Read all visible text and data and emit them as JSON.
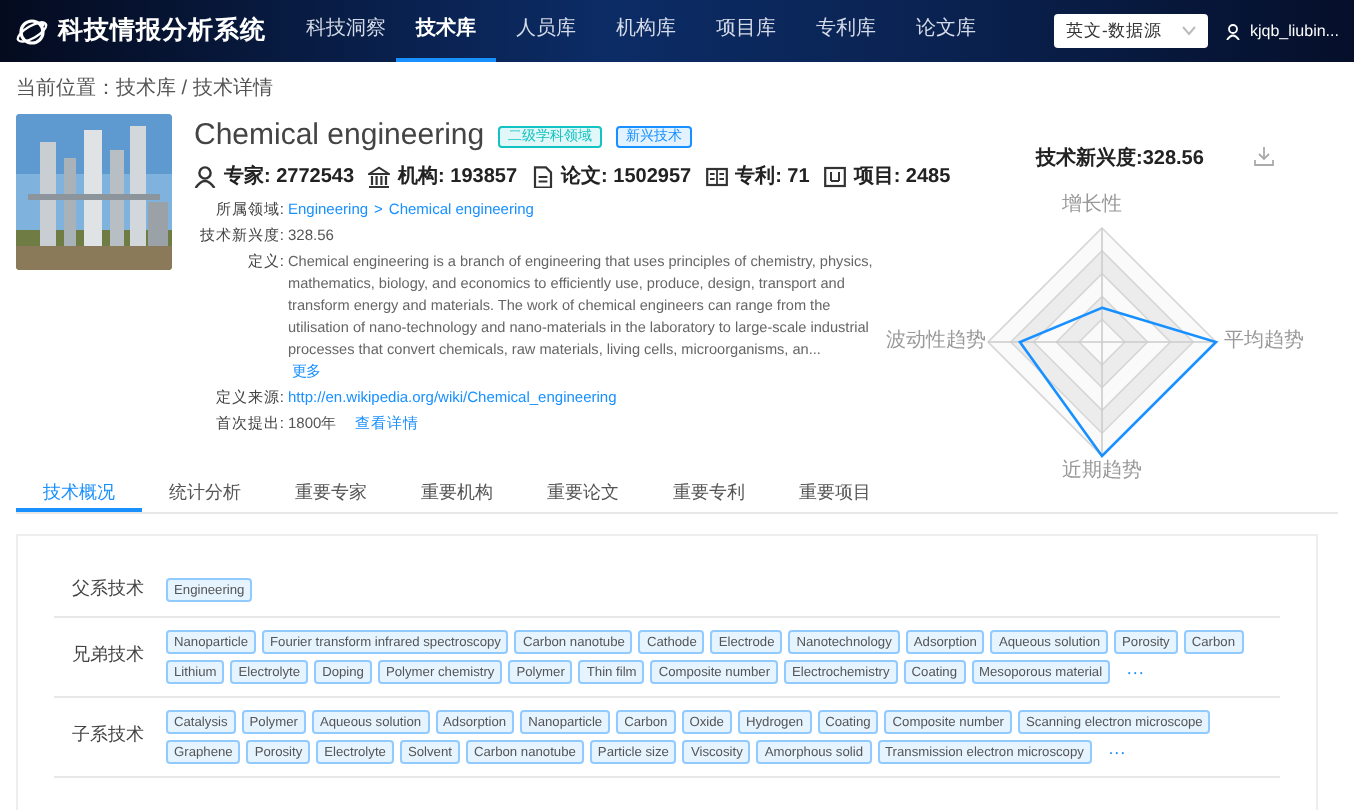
{
  "header": {
    "app_title": "科技情报分析系统",
    "nav": [
      {
        "label": "科技洞察",
        "selected": false
      },
      {
        "label": "技术库",
        "selected": true
      },
      {
        "label": "人员库",
        "selected": false
      },
      {
        "label": "机构库",
        "selected": false
      },
      {
        "label": "项目库",
        "selected": false
      },
      {
        "label": "专利库",
        "selected": false
      },
      {
        "label": "论文库",
        "selected": false
      }
    ],
    "source_select": {
      "value": "英文-数据源"
    },
    "user": "kjqb_liubin..."
  },
  "breadcrumb": "当前位置：技术库 / 技术详情",
  "technology": {
    "name": "Chemical engineering",
    "badges": [
      {
        "label": "二级学科领域",
        "color": "#13c2c2"
      },
      {
        "label": "新兴技术",
        "color": "#1890ff"
      }
    ],
    "stats": [
      {
        "kind": "person",
        "text": "专家: 2772543"
      },
      {
        "kind": "institution",
        "text": "机构: 193857"
      },
      {
        "kind": "paper",
        "text": "论文: 1502957"
      },
      {
        "kind": "patent",
        "text": "专利: 71"
      },
      {
        "kind": "project",
        "text": "项目: 2485"
      }
    ],
    "fields": [
      {
        "kind": "path",
        "label": "所属领域:",
        "links": [
          "Engineering",
          "Chemical engineering"
        ],
        "separator": ">"
      },
      {
        "kind": "text",
        "label": "技术新兴度:",
        "value": "328.56"
      },
      {
        "kind": "definition",
        "label": "定义:",
        "value": "Chemical engineering is a branch of engineering that uses principles of chemistry, physics, mathematics, biology, and economics to efficiently use, produce, design, transport and transform energy and materials. The work of chemical engineers can range from the utilisation of nano-technology and nano-materials in the laboratory to large-scale industrial processes that convert chemicals, raw materials, living cells, microorganisms, an...",
        "more": "更多"
      },
      {
        "kind": "link",
        "label": "定义来源:",
        "link": "http://en.wikipedia.org/wiki/Chemical_engineering"
      },
      {
        "kind": "year",
        "label": "首次提出:",
        "value": "1800年",
        "link": "查看详情"
      }
    ]
  },
  "radar": {
    "title": "技术新兴度:328.56",
    "axes": [
      "增长性",
      "平均趋势",
      "近期趋势",
      "波动性趋势"
    ]
  },
  "tabs": [
    {
      "label": "技术概况",
      "selected": true
    },
    {
      "label": "统计分析",
      "selected": false
    },
    {
      "label": "重要专家",
      "selected": false
    },
    {
      "label": "重要机构",
      "selected": false
    },
    {
      "label": "重要论文",
      "selected": false
    },
    {
      "label": "重要专利",
      "selected": false
    },
    {
      "label": "重要项目",
      "selected": false
    }
  ],
  "relations": [
    {
      "label": "父系技术",
      "tags": [
        "Engineering"
      ]
    },
    {
      "label": "兄弟技术",
      "tags": [
        "Nanoparticle",
        "Fourier transform infrared spectroscopy",
        "Carbon nanotube",
        "Cathode",
        "Electrode",
        "Nanotechnology",
        "Adsorption",
        "Aqueous solution",
        "Porosity",
        "Carbon",
        "Lithium",
        "Electrolyte",
        "Doping",
        "Polymer chemistry",
        "Polymer",
        "Thin film",
        "Composite number",
        "Electrochemistry",
        "Coating",
        "Mesoporous material"
      ],
      "more": "···"
    },
    {
      "label": "子系技术",
      "tags": [
        "Catalysis",
        "Polymer",
        "Aqueous solution",
        "Adsorption",
        "Nanoparticle",
        "Carbon",
        "Oxide",
        "Hydrogen",
        "Coating",
        "Composite number",
        "Scanning electron microscope",
        "Graphene",
        "Porosity",
        "Electrolyte",
        "Solvent",
        "Carbon nanotube",
        "Particle size",
        "Viscosity",
        "Amorphous solid",
        "Transmission electron microscopy"
      ],
      "more": "···"
    }
  ]
}
